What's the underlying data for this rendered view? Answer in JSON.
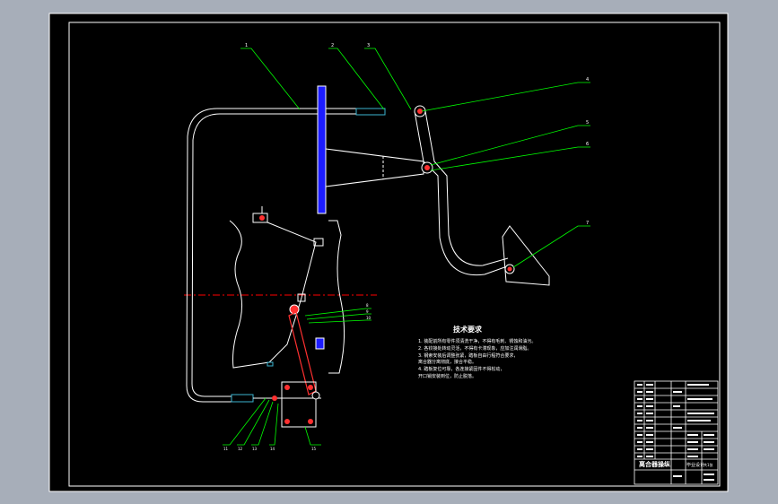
{
  "colors": {
    "viewport_bg": "#a7aeb9",
    "paper": "#000000",
    "frame": "#ffffff",
    "leader": "#00ff00",
    "centerline": "#ff0000",
    "part_blue": "#1c1cff",
    "link_red": "#ff3030",
    "part_cyan": "#3bb4d0"
  },
  "callouts": {
    "top_labels": [
      "1",
      "2",
      "3"
    ],
    "right_labels": [
      "4",
      "5",
      "6",
      "7"
    ],
    "mid_labels": [
      "8",
      "9",
      "10"
    ],
    "bottom_labels": [
      "11",
      "12",
      "13",
      "14",
      "15"
    ]
  },
  "tech_notes": {
    "heading": "技术要求",
    "lines": [
      "1. 装配前所有零件须清洗干净，不得有毛刺、锈蚀和油污。",
      "2. 各铰接处转动灵活，不得有卡滞现象，应加注润滑脂。",
      "3. 钢索安装后调整张紧，踏板自由行程符合要求，",
      "   离合器分离彻底，接合平稳。",
      "4. 踏板复位可靠，各连接紧固件不得松动，",
      "   开口销安装到位，防止脱落。"
    ]
  },
  "title_block": {
    "drawing_name": "离合器操纵",
    "design_label": "毕业设计",
    "sheet_info": "共1张"
  }
}
